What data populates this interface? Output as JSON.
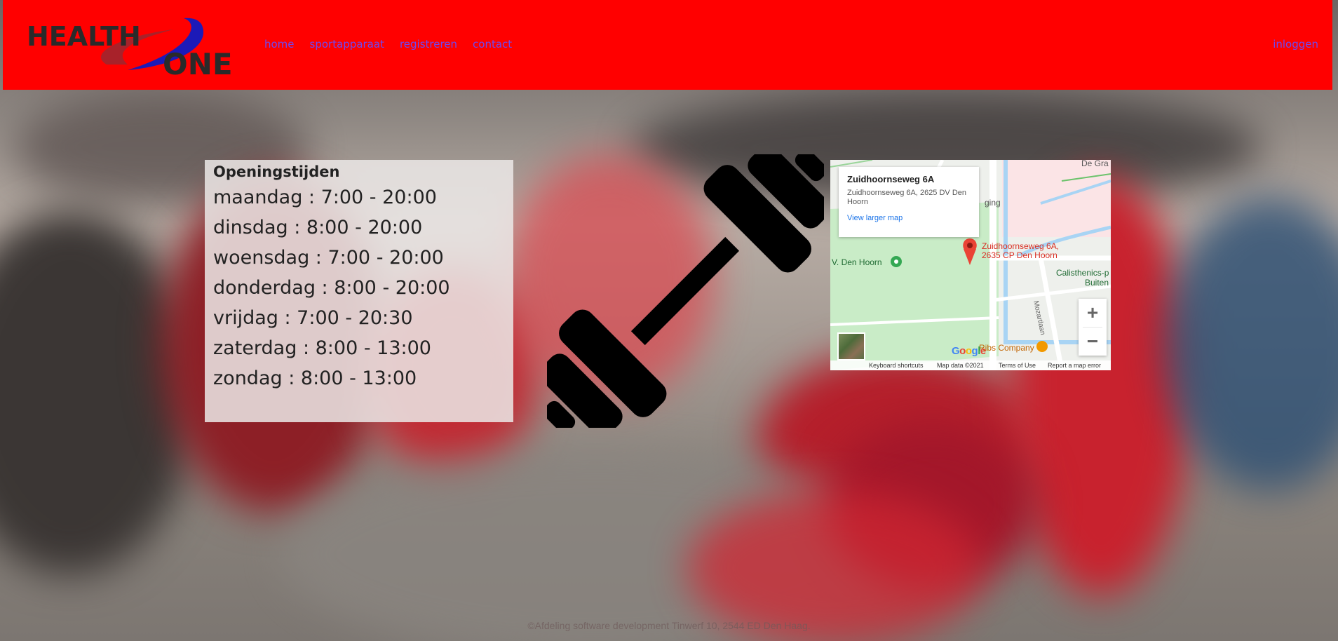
{
  "brand": {
    "logo_top": "HEALTH",
    "logo_bottom": "ONE",
    "colors": {
      "header": "#ff0000",
      "nav_link": "#6f48f0"
    }
  },
  "nav": {
    "items": [
      {
        "label": "home"
      },
      {
        "label": "sportapparaat"
      },
      {
        "label": "registreren"
      },
      {
        "label": "contact"
      }
    ],
    "login": "inloggen"
  },
  "hours": {
    "title": "Openingstijden",
    "days": [
      {
        "text": "maandag : 7:00 - 20:00"
      },
      {
        "text": "dinsdag : 8:00 - 20:00"
      },
      {
        "text": "woensdag : 7:00 - 20:00"
      },
      {
        "text": "donderdag : 8:00 - 20:00"
      },
      {
        "text": "vrijdag : 7:00 - 20:30"
      },
      {
        "text": "zaterdag : 8:00 - 13:00"
      },
      {
        "text": "zondag : 8:00 - 13:00"
      }
    ]
  },
  "center_icon": "dumbbell-icon",
  "map": {
    "card_title": "Zuidhoornseweg 6A",
    "card_address": "Zuidhoornseweg 6A, 2625 DV Den Hoorn",
    "card_link": "View larger map",
    "pin_label_line1": "Zuidhoornseweg 6A,",
    "pin_label_line2": "2635 CP Den Hoorn",
    "places": {
      "den_hoorn": "V. Den Hoorn",
      "calisthenics": "Calisthenics-p",
      "buiten": "Buiten",
      "ribs": "Ribs Company",
      "ging": "ging",
      "de_gr": "De Gra",
      "street": "Mozartlaan"
    },
    "zoom_in": "+",
    "zoom_out": "−",
    "google": "Google",
    "footer": {
      "shortcuts": "Keyboard shortcuts",
      "data": "Map data ©2021",
      "terms": "Terms of Use",
      "report": "Report a map error"
    }
  },
  "footer": {
    "text": "©Afdeling software development Tinwerf 10, 2544 ED Den Haag."
  }
}
